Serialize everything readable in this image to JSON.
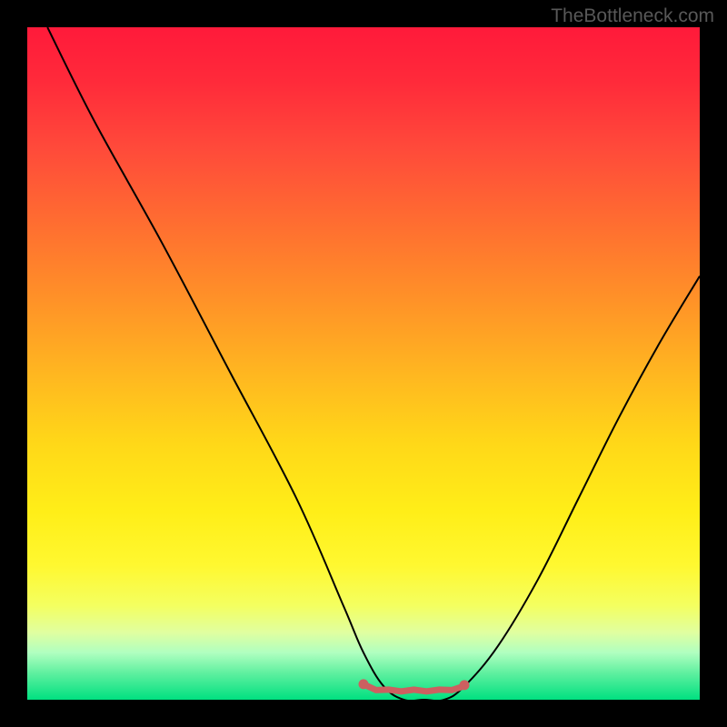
{
  "watermark": "TheBottleneck.com",
  "chart_data": {
    "type": "line",
    "title": "",
    "xlabel": "",
    "ylabel": "",
    "xlim": [
      0,
      100
    ],
    "ylim": [
      0,
      100
    ],
    "series": [
      {
        "name": "curve",
        "x": [
          3,
          10,
          20,
          30,
          40,
          47,
          50,
          53,
          56,
          59,
          62,
          65,
          70,
          76,
          82,
          88,
          94,
          100
        ],
        "values": [
          100,
          86,
          68,
          49,
          30,
          14,
          7,
          2,
          0,
          0,
          0,
          2,
          8,
          18,
          30,
          42,
          53,
          63
        ]
      }
    ],
    "highlight": {
      "x_start": 50,
      "x_end": 65,
      "y": 1.5
    },
    "background_gradient_stops": [
      {
        "pos": 0,
        "color": "#ff1a3a"
      },
      {
        "pos": 50,
        "color": "#ffb820"
      },
      {
        "pos": 80,
        "color": "#fff830"
      },
      {
        "pos": 100,
        "color": "#00e080"
      }
    ]
  }
}
